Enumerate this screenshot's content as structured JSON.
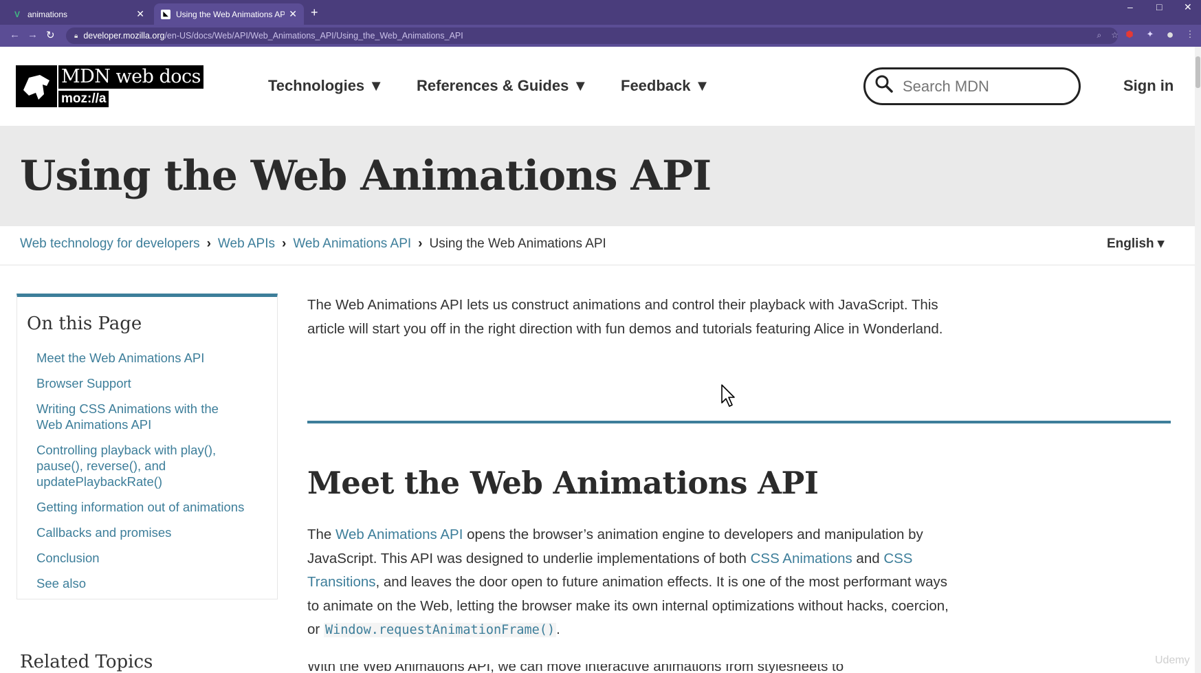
{
  "browser": {
    "tabs": [
      {
        "title": "animations",
        "favicon": "vue-logo-icon",
        "active": false
      },
      {
        "title": "Using the Web Animations API -",
        "favicon": "mdn-dino-icon",
        "active": true
      }
    ],
    "new_tab": "+",
    "window_controls": [
      "–",
      "□",
      "✕"
    ],
    "url_host": "developer.mozilla.org",
    "url_path": "/en-US/docs/Web/API/Web_Animations_API/Using_the_Web_Animations_API",
    "accent": "#4a3d7c"
  },
  "header": {
    "logo_text": "MDN web docs",
    "logo_sub": "moz://a",
    "nav": [
      "Technologies ▼",
      "References & Guides ▼",
      "Feedback ▼"
    ],
    "search_placeholder": "Search MDN",
    "sign_in": "Sign in"
  },
  "page": {
    "title": "Using the Web Animations API",
    "breadcrumbs": [
      "Web technology for developers",
      "Web APIs",
      "Web Animations API"
    ],
    "breadcrumb_current": "Using the Web Animations API",
    "language": "English ▾"
  },
  "toc": {
    "heading": "On this Page",
    "items": [
      "Meet the Web Animations API",
      "Browser Support",
      "Writing CSS Animations with the Web Animations API",
      "Controlling playback with play(), pause(), reverse(), and updatePlaybackRate()",
      "Getting information out of animations",
      "Callbacks and promises",
      "Conclusion",
      "See also"
    ],
    "related_heading": "Related Topics"
  },
  "article": {
    "intro": "The Web Animations API lets us construct animations and control their playback with JavaScript. This article will start you off in the right direction with fun demos and tutorials featuring Alice in Wonderland.",
    "section_heading": "Meet the Web Animations API",
    "p1": {
      "t1": "The ",
      "link1": "Web Animations API",
      "t2": " opens the browser’s animation engine to developers and manipulation by JavaScript. This API was designed to underlie implementations of both ",
      "link2": "CSS Animations",
      "t3": " and ",
      "link3": "CSS Transitions",
      "t4": ", and leaves the door open to future animation effects. It is one of the most performant ways to animate on the Web, letting the browser make its own internal optimizations without hacks, coercion, or ",
      "code": "Window.requestAnimationFrame()",
      "t5": "."
    },
    "next_line_partial": "With the Web Animations API, we can move interactive animations from stylesheets to"
  },
  "watermark": "Udemy",
  "colors": {
    "link": "#3d7e9a",
    "title_band": "#eaeaea"
  }
}
